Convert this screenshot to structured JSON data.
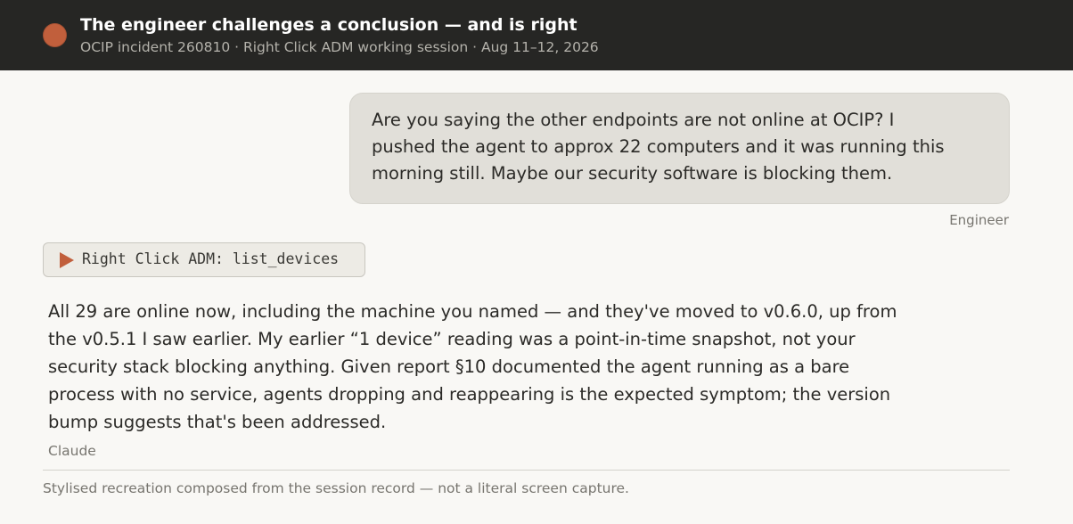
{
  "header": {
    "title": "The engineer challenges a conclusion — and is right",
    "subtitle": "OCIP incident 260810 · Right Click ADM working session · Aug 11–12, 2026",
    "avatar_icon": "avatar-circle",
    "accent_color": "#c15f3c"
  },
  "messages": {
    "user": {
      "lines": [
        "Are you saying the other endpoints are not online at OCIP? I",
        "pushed the agent to approx 22 computers and it was running this",
        "morning still. Maybe our security software is blocking them."
      ],
      "label": "Engineer"
    },
    "tool_call": {
      "icon": "play-icon",
      "label": "Right Click ADM: list_devices"
    },
    "assistant": {
      "lines": [
        "All 29 are online now, including the machine you named — and they've moved to v0.6.0, up from",
        "the v0.5.1 I saw earlier. My earlier “1 device” reading was a point-in-time snapshot, not your",
        "security stack blocking anything. Given report §10 documented the agent running as a bare",
        "process with no service, agents dropping and reappearing is the expected symptom; the version",
        "bump suggests that's been addressed."
      ],
      "label": "Claude"
    }
  },
  "footer": {
    "note": "Stylised recreation composed from the session record — not a literal screen capture."
  }
}
